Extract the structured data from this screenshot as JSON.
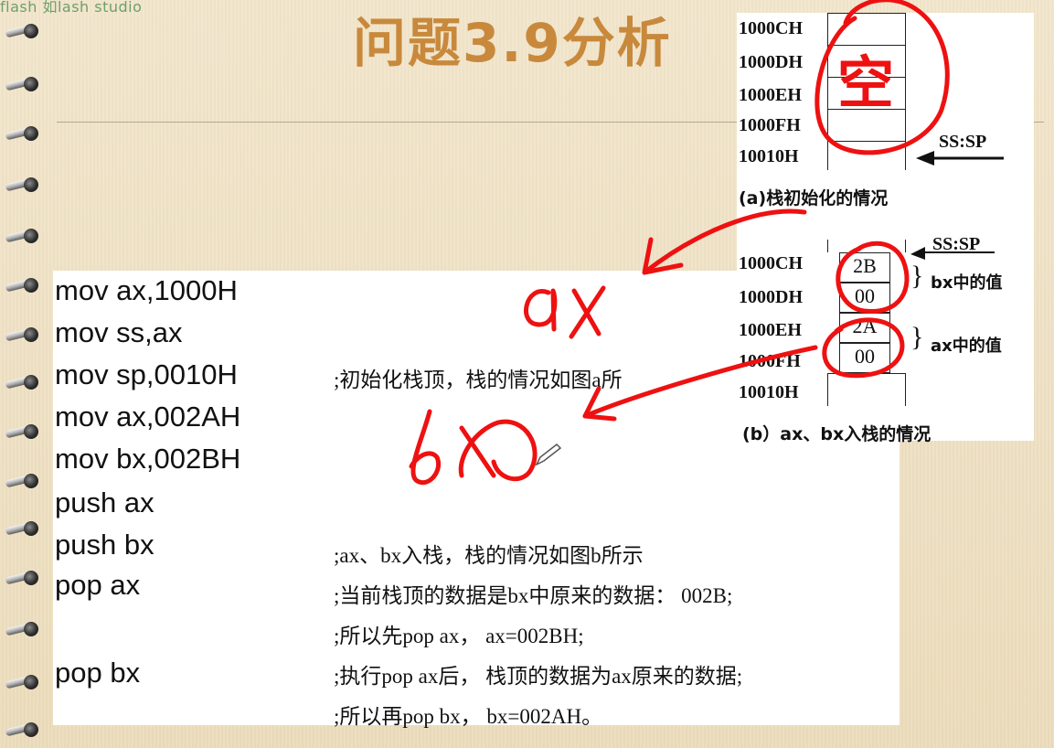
{
  "watermark": "flash 如lash studio",
  "title": "问题3.9分析",
  "code_lines": [
    "mov ax,1000H",
    "mov ss,ax",
    "mov sp,0010H",
    "mov ax,002AH",
    "mov bx,002BH",
    "push ax",
    "push bx",
    "pop ax",
    "pop bx"
  ],
  "comments": [
    ";初始化栈顶，栈的情况如图a所",
    ";ax、bx入栈，栈的情况如图b所示",
    ";当前栈顶的数据是bx中原来的数据：  002B;",
    ";所以先pop ax，  ax=002BH;",
    ";执行pop ax后，  栈顶的数据为ax原来的数据;",
    ";所以再pop bx，  bx=002AH。"
  ],
  "figure_a": {
    "addresses": [
      "1000CH",
      "1000DH",
      "1000EH",
      "1000FH",
      "10010H"
    ],
    "pointer": "SS:SP",
    "caption": "(a)栈初始化的情况"
  },
  "figure_b": {
    "addresses": [
      "1000CH",
      "1000DH",
      "1000EH",
      "1000FH",
      "10010H"
    ],
    "cells": [
      "2B",
      "00",
      "2A",
      "00",
      ""
    ],
    "pointer": "SS:SP",
    "bx_note": "bx中的值",
    "ax_note": "ax中的值",
    "caption": "(b）ax、bx入栈的情况"
  },
  "annotations": {
    "empty": "空",
    "ax": "ax",
    "bx": "bx"
  },
  "colors": {
    "background": "#efe2c6",
    "title": "#c8893c",
    "ink": "#ee1111",
    "watermark": "#6f9f6a"
  }
}
